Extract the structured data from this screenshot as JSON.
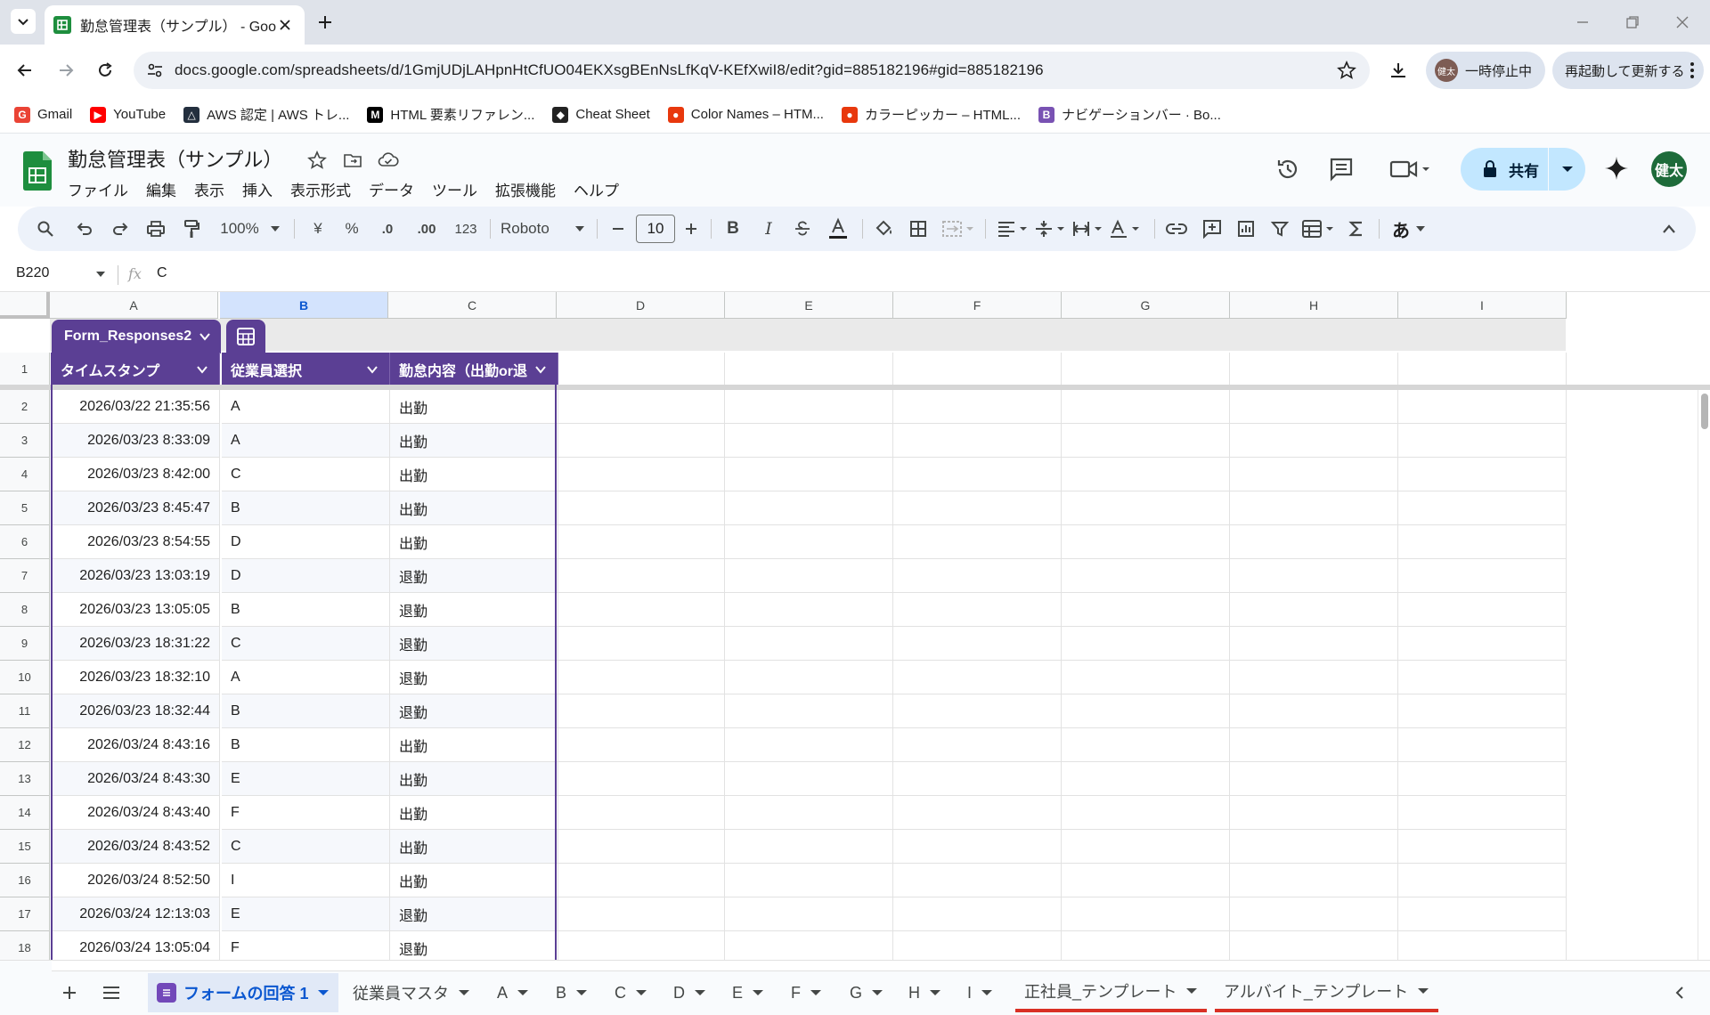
{
  "browser": {
    "tab_title": "勤怠管理表（サンプル） - Google",
    "url": "docs.google.com/spreadsheets/d/1GmjUDjLAHpnHtCfUO04EKXsgBEnNsLfKqV-KEfXwiI8/edit?gid=885182196#gid=885182196",
    "profile_small": "健太",
    "paused_label": "一時停止中",
    "restart_label": "再起動して更新する",
    "bookmarks": [
      {
        "label": "Gmail",
        "color": "#ea4335",
        "glyph": "G"
      },
      {
        "label": "YouTube",
        "color": "#ff0000",
        "glyph": "▶"
      },
      {
        "label": "AWS 認定 | AWS トレ...",
        "color": "#232f3e",
        "glyph": "△"
      },
      {
        "label": "HTML 要素リファレン...",
        "color": "#000000",
        "glyph": "M"
      },
      {
        "label": "Cheat Sheet",
        "color": "#222222",
        "glyph": "◆"
      },
      {
        "label": "Color Names – HTM...",
        "color": "#e8380d",
        "glyph": "●"
      },
      {
        "label": "カラーピッカー – HTML...",
        "color": "#e8380d",
        "glyph": "●"
      },
      {
        "label": "ナビゲーションバー · Bo...",
        "color": "#7952b3",
        "glyph": "B"
      }
    ]
  },
  "doc": {
    "title": "勤怠管理表（サンプル）",
    "menu": [
      "ファイル",
      "編集",
      "表示",
      "挿入",
      "表示形式",
      "データ",
      "ツール",
      "拡張機能",
      "ヘルプ"
    ],
    "share_label": "共有",
    "user_avatar": "健太"
  },
  "toolbar": {
    "zoom": "100%",
    "currency": "¥",
    "percent": "%",
    "dec_down": ".0",
    "dec_up": ".00",
    "format_123": "123",
    "font": "Roboto",
    "font_size": "10",
    "bold": "B",
    "italic": "I",
    "ime": "あ"
  },
  "formula_bar": {
    "cell_ref": "B220",
    "fx": "fx",
    "value": "C"
  },
  "grid": {
    "columns": [
      "A",
      "B",
      "C",
      "D",
      "E",
      "F",
      "G",
      "H",
      "I"
    ],
    "selected_column": "B",
    "table_name": "Form_Responses2",
    "header_row_number": "1",
    "headers": [
      "タイムスタンプ",
      "従業員選択",
      "勤怠内容（出勤or退"
    ],
    "rows": [
      {
        "n": "2",
        "ts": "2026/03/22 21:35:56",
        "emp": "A",
        "kind": "出勤"
      },
      {
        "n": "3",
        "ts": "2026/03/23 8:33:09",
        "emp": "A",
        "kind": "出勤"
      },
      {
        "n": "4",
        "ts": "2026/03/23 8:42:00",
        "emp": "C",
        "kind": "出勤"
      },
      {
        "n": "5",
        "ts": "2026/03/23 8:45:47",
        "emp": "B",
        "kind": "出勤"
      },
      {
        "n": "6",
        "ts": "2026/03/23 8:54:55",
        "emp": "D",
        "kind": "出勤"
      },
      {
        "n": "7",
        "ts": "2026/03/23 13:03:19",
        "emp": "D",
        "kind": "退勤"
      },
      {
        "n": "8",
        "ts": "2026/03/23 13:05:05",
        "emp": "B",
        "kind": "退勤"
      },
      {
        "n": "9",
        "ts": "2026/03/23 18:31:22",
        "emp": "C",
        "kind": "退勤"
      },
      {
        "n": "10",
        "ts": "2026/03/23 18:32:10",
        "emp": "A",
        "kind": "退勤"
      },
      {
        "n": "11",
        "ts": "2026/03/23 18:32:44",
        "emp": "B",
        "kind": "退勤"
      },
      {
        "n": "12",
        "ts": "2026/03/24 8:43:16",
        "emp": "B",
        "kind": "出勤"
      },
      {
        "n": "13",
        "ts": "2026/03/24 8:43:30",
        "emp": "E",
        "kind": "出勤"
      },
      {
        "n": "14",
        "ts": "2026/03/24 8:43:40",
        "emp": "F",
        "kind": "出勤"
      },
      {
        "n": "15",
        "ts": "2026/03/24 8:43:52",
        "emp": "C",
        "kind": "出勤"
      },
      {
        "n": "16",
        "ts": "2026/03/24 8:52:50",
        "emp": "I",
        "kind": "出勤"
      },
      {
        "n": "17",
        "ts": "2026/03/24 12:13:03",
        "emp": "E",
        "kind": "退勤"
      },
      {
        "n": "18",
        "ts": "2026/03/24 13:05:04",
        "emp": "F",
        "kind": "退勤"
      }
    ]
  },
  "sheet_tabs": {
    "tabs": [
      {
        "label": "フォームの回答 1",
        "active": true,
        "underline": false
      },
      {
        "label": "従業員マスタ",
        "active": false,
        "underline": false
      },
      {
        "label": "A",
        "active": false,
        "underline": false
      },
      {
        "label": "B",
        "active": false,
        "underline": false
      },
      {
        "label": "C",
        "active": false,
        "underline": false
      },
      {
        "label": "D",
        "active": false,
        "underline": false
      },
      {
        "label": "E",
        "active": false,
        "underline": false
      },
      {
        "label": "F",
        "active": false,
        "underline": false
      },
      {
        "label": "G",
        "active": false,
        "underline": false
      },
      {
        "label": "H",
        "active": false,
        "underline": false
      },
      {
        "label": "I",
        "active": false,
        "underline": false
      },
      {
        "label": "正社員_テンプレート",
        "active": false,
        "underline": true
      },
      {
        "label": "アルバイト_テンプレート",
        "active": false,
        "underline": true
      }
    ]
  }
}
